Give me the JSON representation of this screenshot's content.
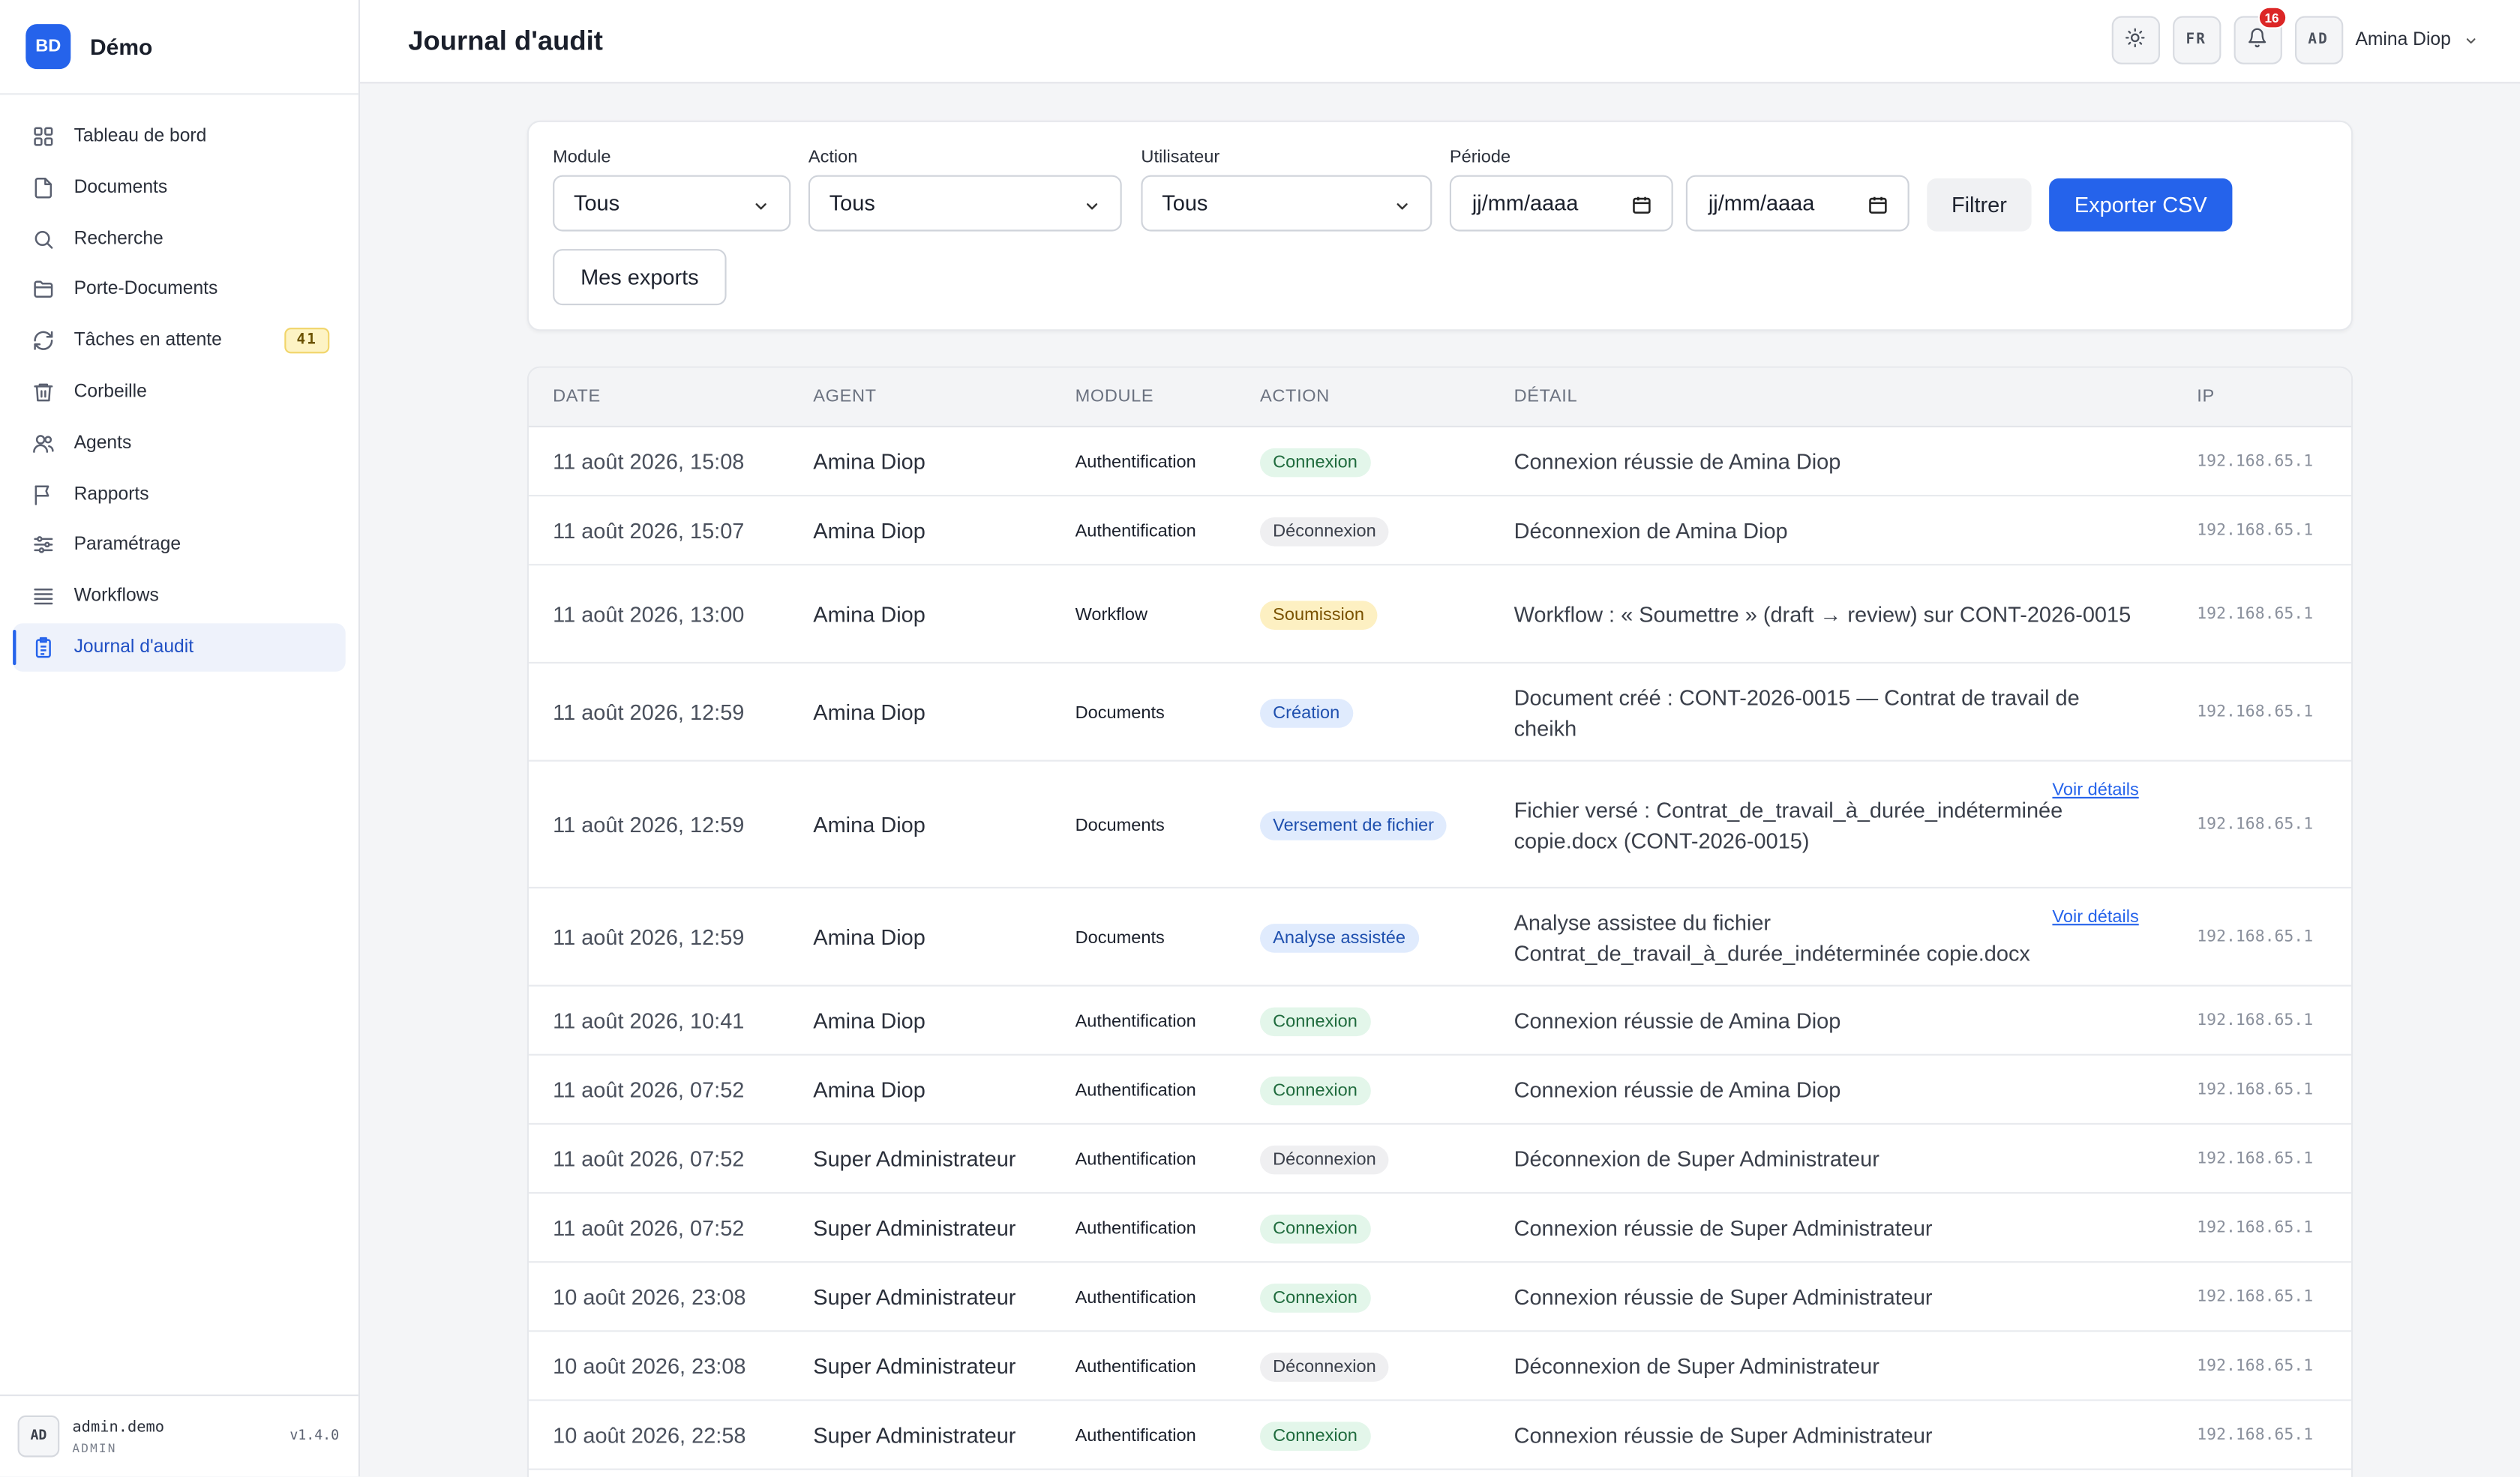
{
  "brand": {
    "logo": "BD",
    "name": "Démo"
  },
  "sidebar": {
    "items": [
      {
        "label": "Tableau de bord",
        "icon": "dashboard-icon"
      },
      {
        "label": "Documents",
        "icon": "document-icon"
      },
      {
        "label": "Recherche",
        "icon": "search-icon"
      },
      {
        "label": "Porte-Documents",
        "icon": "folder-icon"
      },
      {
        "label": "Tâches en attente",
        "icon": "refresh-icon",
        "badge": "41"
      },
      {
        "label": "Corbeille",
        "icon": "trash-icon"
      },
      {
        "label": "Agents",
        "icon": "users-icon"
      },
      {
        "label": "Rapports",
        "icon": "flag-icon"
      },
      {
        "label": "Paramétrage",
        "icon": "sliders-icon"
      },
      {
        "label": "Workflows",
        "icon": "list-icon"
      },
      {
        "label": "Journal d'audit",
        "icon": "clipboard-icon",
        "active": true
      }
    ],
    "footer": {
      "avatar": "AD",
      "username": "admin.demo",
      "role": "ADMIN",
      "version": "v1.4.0"
    }
  },
  "header": {
    "title": "Journal d'audit",
    "lang": "FR",
    "notifications": "16",
    "user_initials": "AD",
    "user_name": "Amina Diop"
  },
  "filters": {
    "module_label": "Module",
    "module_value": "Tous",
    "action_label": "Action",
    "action_value": "Tous",
    "user_label": "Utilisateur",
    "user_value": "Tous",
    "period_label": "Période",
    "date_from": "jj/mm/aaaa",
    "date_to": "jj/mm/aaaa",
    "filter_button": "Filtrer",
    "export_button": "Exporter CSV",
    "my_exports_button": "Mes exports"
  },
  "table": {
    "headers": {
      "date": "DATE",
      "agent": "AGENT",
      "module": "MODULE",
      "action": "ACTION",
      "detail": "DÉTAIL",
      "ip": "IP"
    },
    "rows": [
      {
        "date": "11 août 2026, 15:08",
        "agent": "Amina Diop",
        "module": "Authentification",
        "action": "Connexion",
        "kind": "login",
        "detail": "Connexion réussie de Amina Diop",
        "ip": "192.168.65.1"
      },
      {
        "date": "11 août 2026, 15:07",
        "agent": "Amina Diop",
        "module": "Authentification",
        "action": "Déconnexion",
        "kind": "logout",
        "detail": "Déconnexion de Amina Diop",
        "ip": "192.168.65.1"
      },
      {
        "date": "11 août 2026, 13:00",
        "agent": "Amina Diop",
        "module": "Workflow",
        "action": "Soumission",
        "kind": "submit",
        "detail": "Workflow : « Soumettre » (draft → review) sur CONT-2026-0015",
        "ip": "192.168.65.1"
      },
      {
        "date": "11 août 2026, 12:59",
        "agent": "Amina Diop",
        "module": "Documents",
        "action": "Création",
        "kind": "create",
        "detail": "Document créé : CONT-2026-0015 — Contrat de travail de cheikh",
        "ip": "192.168.65.1"
      },
      {
        "date": "11 août 2026, 12:59",
        "agent": "Amina Diop",
        "module": "Documents",
        "action": "Versement de fichier",
        "kind": "upload",
        "detail": "Fichier versé : Contrat_de_travail_à_durée_indéterminée copie.docx (CONT-2026-0015)",
        "link": "Voir détails",
        "ip": "192.168.65.1"
      },
      {
        "date": "11 août 2026, 12:59",
        "agent": "Amina Diop",
        "module": "Documents",
        "action": "Analyse assistée",
        "kind": "analysis",
        "detail": "Analyse assistee du fichier Contrat_de_travail_à_durée_indéterminée copie.docx",
        "link": "Voir détails",
        "ip": "192.168.65.1"
      },
      {
        "date": "11 août 2026, 10:41",
        "agent": "Amina Diop",
        "module": "Authentification",
        "action": "Connexion",
        "kind": "login",
        "detail": "Connexion réussie de Amina Diop",
        "ip": "192.168.65.1"
      },
      {
        "date": "11 août 2026, 07:52",
        "agent": "Amina Diop",
        "module": "Authentification",
        "action": "Connexion",
        "kind": "login",
        "detail": "Connexion réussie de Amina Diop",
        "ip": "192.168.65.1"
      },
      {
        "date": "11 août 2026, 07:52",
        "agent": "Super Administrateur",
        "module": "Authentification",
        "action": "Déconnexion",
        "kind": "logout",
        "detail": "Déconnexion de Super Administrateur",
        "ip": "192.168.65.1"
      },
      {
        "date": "11 août 2026, 07:52",
        "agent": "Super Administrateur",
        "module": "Authentification",
        "action": "Connexion",
        "kind": "login",
        "detail": "Connexion réussie de Super Administrateur",
        "ip": "192.168.65.1"
      },
      {
        "date": "10 août 2026, 23:08",
        "agent": "Super Administrateur",
        "module": "Authentification",
        "action": "Connexion",
        "kind": "login",
        "detail": "Connexion réussie de Super Administrateur",
        "ip": "192.168.65.1"
      },
      {
        "date": "10 août 2026, 23:08",
        "agent": "Super Administrateur",
        "module": "Authentification",
        "action": "Déconnexion",
        "kind": "logout",
        "detail": "Déconnexion de Super Administrateur",
        "ip": "192.168.65.1"
      },
      {
        "date": "10 août 2026, 22:58",
        "agent": "Super Administrateur",
        "module": "Authentification",
        "action": "Connexion",
        "kind": "login",
        "detail": "Connexion réussie de Super Administrateur",
        "ip": "192.168.65.1"
      }
    ]
  }
}
